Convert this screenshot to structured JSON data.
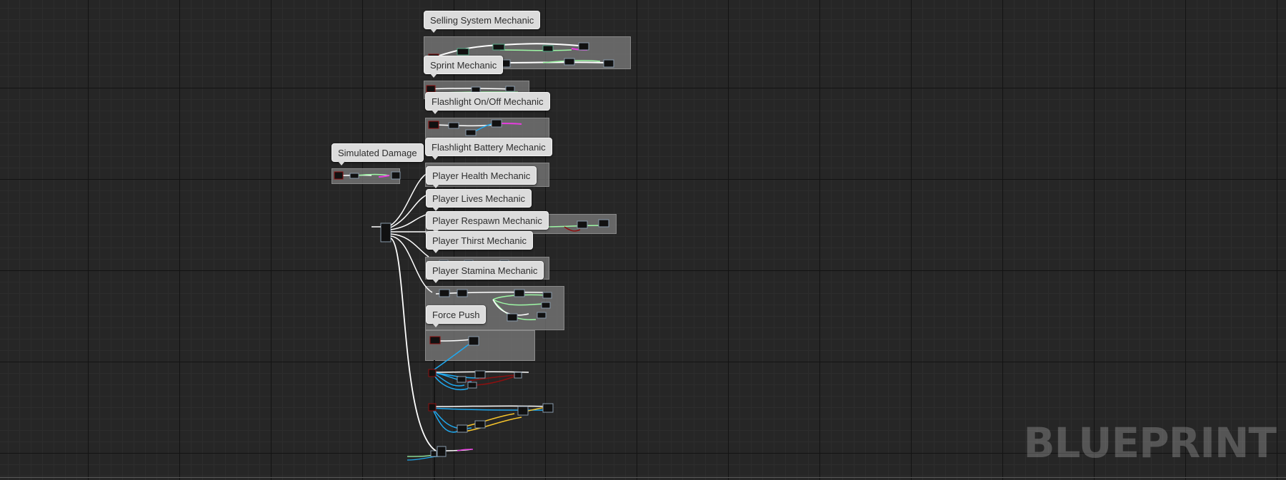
{
  "graph": {
    "comments": [
      {
        "id": "selling-system",
        "title": "Selling System Mechanic"
      },
      {
        "id": "sprint",
        "title": "Sprint Mechanic"
      },
      {
        "id": "flashlight-onoff",
        "title": "Flashlight On/Off Mechanic"
      },
      {
        "id": "simulated-damage",
        "title": "Simulated Damage"
      },
      {
        "id": "flashlight-battery",
        "title": "Flashlight Battery Mechanic"
      },
      {
        "id": "player-health",
        "title": "Player Health Mechanic"
      },
      {
        "id": "player-lives",
        "title": "Player Lives Mechanic"
      },
      {
        "id": "player-respawn",
        "title": "Player Respawn Mechanic"
      },
      {
        "id": "player-thirst",
        "title": "Player Thirst Mechanic"
      },
      {
        "id": "player-stamina",
        "title": "Player Stamina Mechanic"
      },
      {
        "id": "force-push",
        "title": "Force Push"
      }
    ],
    "wire_colors": {
      "exec": "#ffffff",
      "float": "#9ef8a6",
      "object": "#1fa9f0",
      "boolean": "#8c1010",
      "vector": "#f7c52b",
      "string": "#e83ce0"
    }
  },
  "watermark": "BLUEPRINT"
}
